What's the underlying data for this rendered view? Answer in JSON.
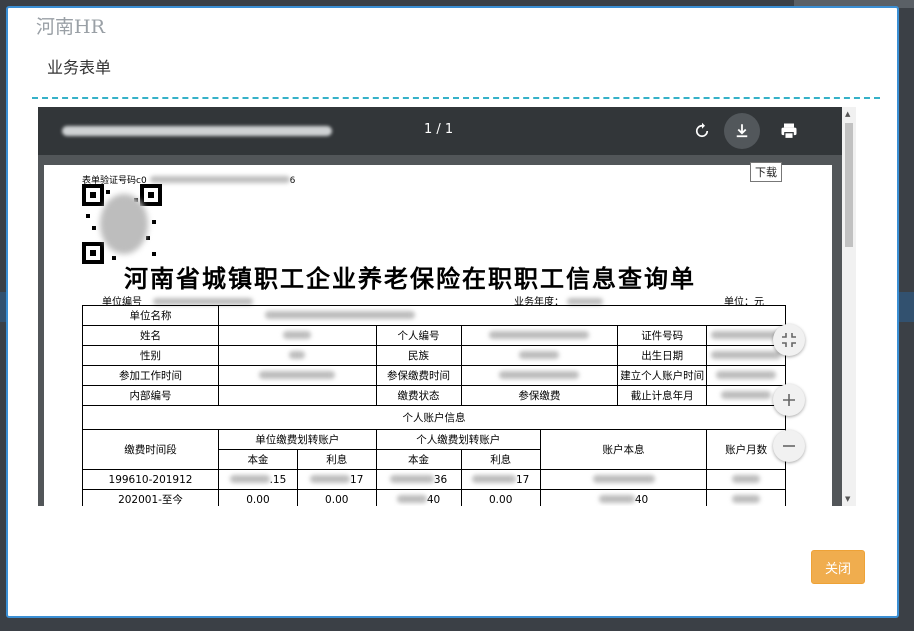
{
  "modal": {
    "brand": "河南HR",
    "subtitle": "业务表单",
    "close_label": "关闭"
  },
  "viewer": {
    "page_indicator": "1 / 1",
    "download_tooltip": "下载",
    "icons": [
      "rotate-icon",
      "download-icon",
      "print-icon",
      "fit-page-icon",
      "zoom-in-icon",
      "zoom-out-icon"
    ]
  },
  "document": {
    "verify_label": "表单验证号码c0",
    "title": "河南省城镇职工企业养老保险在职职工信息查询单",
    "unit_code_label": "单位编号",
    "year_label": "业务年度：",
    "currency_label": "单位：元",
    "fields": {
      "unit_name": "单位名称",
      "name": "姓名",
      "person_no": "个人编号",
      "id_no": "证件号码",
      "gender": "性别",
      "ethnicity": "民族",
      "birth": "出生日期",
      "work_start": "参加工作时间",
      "insured_start": "参保缴费时间",
      "account_start": "建立个人账户时间",
      "internal_no": "内部编号",
      "pay_status": "缴费状态",
      "pay_status_value": "参保缴费",
      "cutoff": "截止计息年月"
    },
    "account_section": "个人账户信息",
    "headers": {
      "period": "缴费时间段",
      "unit_transfer": "单位缴费划转账户",
      "personal_transfer": "个人缴费划转账户",
      "principal": "本金",
      "interest": "利息",
      "balance": "账户本息",
      "months": "账户月数"
    },
    "rows": [
      {
        "period": "199610-201912",
        "unit_principal_tail": ".15",
        "unit_interest_tail": "17",
        "personal_principal_tail": "36",
        "personal_interest_tail": "17"
      },
      {
        "period": "202001-至今",
        "unit_principal": "0.00",
        "unit_interest": "0.00",
        "personal_principal_tail": "40",
        "personal_interest": "0.00",
        "balance_tail": "40"
      }
    ]
  },
  "colors": {
    "modal_border": "#3b8fd4",
    "dash": "#35b1c8",
    "close_button": "#f0ad4e",
    "viewer_toolbar": "#323639"
  }
}
